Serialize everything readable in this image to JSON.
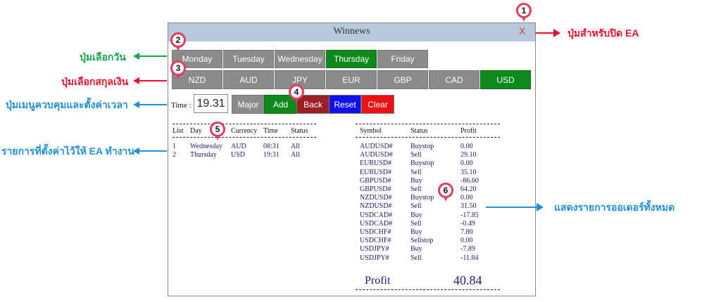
{
  "window": {
    "title": "Winnews",
    "close_label": "X"
  },
  "days": [
    "Monday",
    "Tuesday",
    "Wednesday",
    "Thursday",
    "Friday"
  ],
  "selected_day": "Thursday",
  "currencies": [
    "NZD",
    "AUD",
    "JPY",
    "EUR",
    "GBP",
    "CAD",
    "USD"
  ],
  "selected_currency": "USD",
  "time": {
    "label": "Time :",
    "value": "19.31"
  },
  "actions": {
    "major": "Major",
    "add": "Add",
    "back": "Back",
    "reset": "Reset",
    "clear": "Clear"
  },
  "schedule": {
    "headers": [
      "List",
      "Day",
      "Currency",
      "Time",
      "Status"
    ],
    "rows": [
      [
        "1",
        "Wednesday",
        "AUD",
        "08:31",
        "All"
      ],
      [
        "2",
        "Thursday",
        "USD",
        "19:31",
        "All"
      ]
    ]
  },
  "orders": {
    "headers": [
      "Symbol",
      "Status",
      "Profit"
    ],
    "rows": [
      [
        "AUDUSD#",
        "Buystop",
        "0.00"
      ],
      [
        "AUDUSD#",
        "Sell",
        "29.10"
      ],
      [
        "EURUSD#",
        "Buystop",
        "0.00"
      ],
      [
        "EURUSD#",
        "Sell",
        "35.10"
      ],
      [
        "GBPUSD#",
        "Buy",
        "-86.60"
      ],
      [
        "GBPUSD#",
        "Sell",
        "64.20"
      ],
      [
        "NZDUSD#",
        "Buystop",
        "0.00"
      ],
      [
        "NZDUSD#",
        "Sell",
        "31.50"
      ],
      [
        "USDCAD#",
        "Buy",
        "-17.85"
      ],
      [
        "USDCAD#",
        "Sell",
        "-0.49"
      ],
      [
        "USDCHF#",
        "Buy",
        "7.80"
      ],
      [
        "USDCHF#",
        "Sellstop",
        "0.00"
      ],
      [
        "USDJPY#",
        "Buy",
        "-7.89"
      ],
      [
        "USDJPY#",
        "Sell",
        "-11.84"
      ]
    ],
    "total_label": "Profit",
    "total_value": "40.84"
  },
  "annotations": {
    "close_note": "ปุ่มสำหรับปิด EA",
    "day_note": "ปุ่มเลือกวัน",
    "currency_note": "ปุ่มเลือกสกุลเงิน",
    "menu_note": "ปุ่มเมนูควบคุมและตั้งค่าเวลา",
    "schedule_note": "รายการที่ตั้งค่าไว้ให้ EA ทำงาน",
    "orders_note": "แสดงรายการออเดอร์ทั้งหมด",
    "pins": [
      "1",
      "2",
      "3",
      "4",
      "5",
      "6"
    ]
  },
  "colors": {
    "titlebar": "#b7c9dd",
    "selected": "#0e8a1d",
    "unselected": "#8a8a8a",
    "back": "#9c1f23",
    "reset": "#1010e8",
    "clear": "#ee1111",
    "pin": "#e83b5f",
    "note_red": "#e8102a",
    "note_green": "#16a34a",
    "note_blue": "#1f8fd6"
  }
}
